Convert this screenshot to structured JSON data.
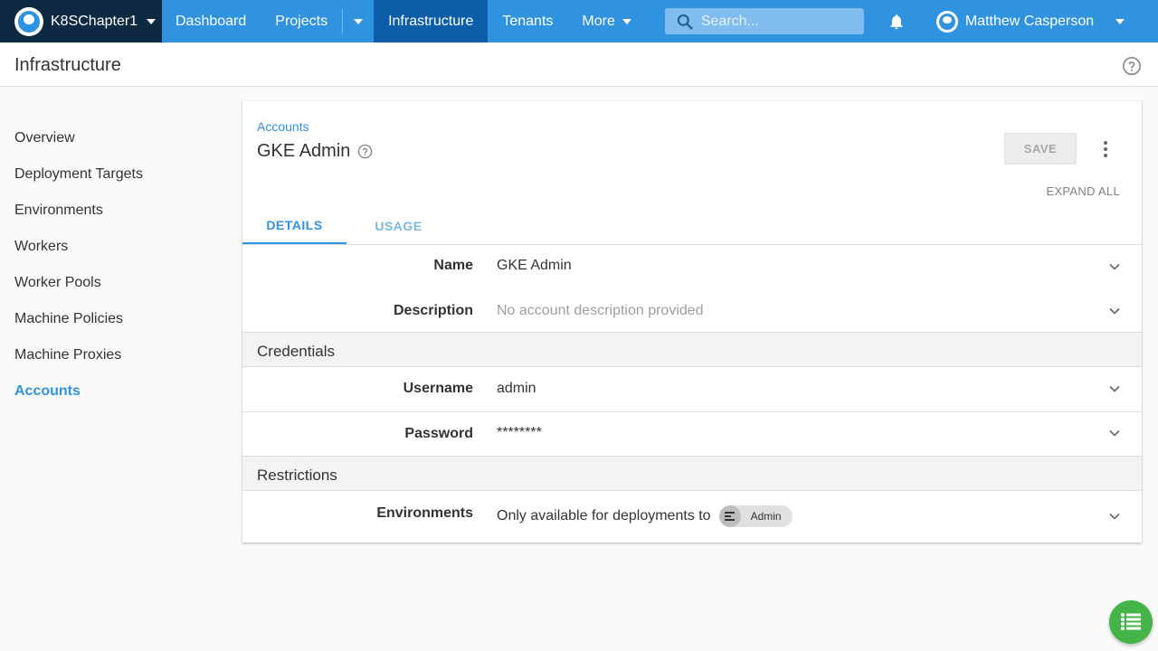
{
  "nav": {
    "space_name": "K8SChapter1",
    "links": {
      "dashboard": "Dashboard",
      "projects": "Projects",
      "infrastructure": "Infrastructure",
      "tenants": "Tenants",
      "more": "More"
    },
    "search_placeholder": "Search...",
    "user_name": "Matthew Casperson",
    "brand_color": "#2f93e0",
    "active_color": "#0c5ea8",
    "space_bg": "#0e2a43"
  },
  "page": {
    "title": "Infrastructure"
  },
  "sidebar": {
    "items": [
      {
        "label": "Overview",
        "active": false
      },
      {
        "label": "Deployment Targets",
        "active": false
      },
      {
        "label": "Environments",
        "active": false
      },
      {
        "label": "Workers",
        "active": false
      },
      {
        "label": "Worker Pools",
        "active": false
      },
      {
        "label": "Machine Policies",
        "active": false
      },
      {
        "label": "Machine Proxies",
        "active": false
      },
      {
        "label": "Accounts",
        "active": true
      }
    ]
  },
  "account": {
    "breadcrumb": "Accounts",
    "title": "GKE Admin",
    "save_label": "SAVE",
    "expand_all": "EXPAND ALL",
    "tabs": {
      "details": "DETAILS",
      "usage": "USAGE"
    },
    "fields": {
      "name_label": "Name",
      "name_value": "GKE Admin",
      "description_label": "Description",
      "description_value": "No account description provided",
      "credentials_heading": "Credentials",
      "username_label": "Username",
      "username_value": "admin",
      "password_label": "Password",
      "password_value": "********",
      "restrictions_heading": "Restrictions",
      "environments_label": "Environments",
      "environments_value": "Only available for deployments to",
      "environment_chip": "Admin"
    }
  },
  "icons": {
    "search": "search-icon",
    "bell": "bell-icon",
    "help": "help-circle-icon",
    "more": "more-vert-icon",
    "chevron": "chevron-down-icon",
    "environment": "environment-icon",
    "task_list": "task-list-icon"
  },
  "fab_color": "#44b449"
}
